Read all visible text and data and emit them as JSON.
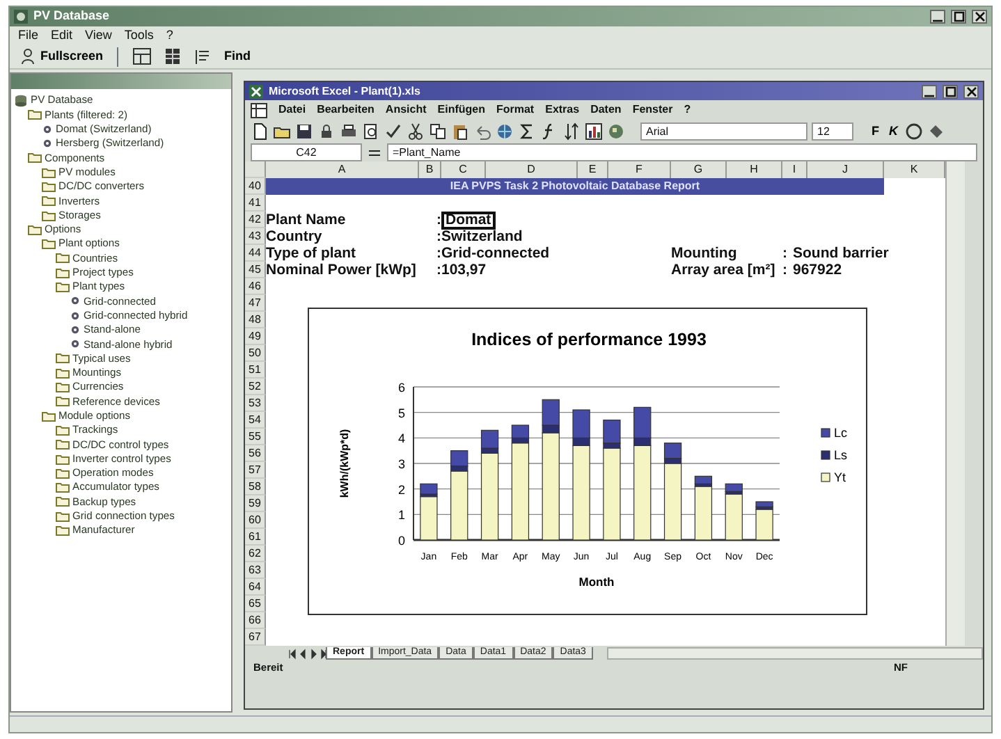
{
  "app": {
    "title": "PV Database",
    "menu": [
      "File",
      "Edit",
      "View",
      "Tools",
      "?"
    ],
    "toolbar": {
      "fullscreen": "Fullscreen",
      "find": "Find"
    }
  },
  "tree": [
    {
      "label": "PV Database",
      "kind": "database",
      "children": [
        {
          "label": "Plants (filtered: 2)",
          "kind": "folder",
          "children": [
            {
              "label": "Domat (Switzerland)",
              "kind": "plant"
            },
            {
              "label": "Hersberg (Switzerland)",
              "kind": "plant"
            }
          ]
        },
        {
          "label": "Components",
          "kind": "folder",
          "children": [
            {
              "label": "PV modules",
              "kind": "folder"
            },
            {
              "label": "DC/DC converters",
              "kind": "folder"
            },
            {
              "label": "Inverters",
              "kind": "folder"
            },
            {
              "label": "Storages",
              "kind": "folder"
            }
          ]
        },
        {
          "label": "Options",
          "kind": "folder",
          "children": [
            {
              "label": "Plant options",
              "kind": "folder",
              "children": [
                {
                  "label": "Countries",
                  "kind": "folder"
                },
                {
                  "label": "Project types",
                  "kind": "folder"
                },
                {
                  "label": "Plant types",
                  "kind": "folder",
                  "children": [
                    {
                      "label": "Grid-connected",
                      "kind": "plant"
                    },
                    {
                      "label": "Grid-connected hybrid",
                      "kind": "plant"
                    },
                    {
                      "label": "Stand-alone",
                      "kind": "plant"
                    },
                    {
                      "label": "Stand-alone hybrid",
                      "kind": "plant"
                    }
                  ]
                },
                {
                  "label": "Typical uses",
                  "kind": "folder"
                },
                {
                  "label": "Mountings",
                  "kind": "folder"
                },
                {
                  "label": "Currencies",
                  "kind": "folder"
                },
                {
                  "label": "Reference devices",
                  "kind": "folder"
                }
              ]
            },
            {
              "label": "Module options",
              "kind": "folder",
              "children": [
                {
                  "label": "Trackings",
                  "kind": "folder"
                },
                {
                  "label": "DC/DC control types",
                  "kind": "folder"
                },
                {
                  "label": "Inverter control types",
                  "kind": "folder"
                },
                {
                  "label": "Operation modes",
                  "kind": "folder"
                },
                {
                  "label": "Accumulator types",
                  "kind": "folder"
                },
                {
                  "label": "Backup types",
                  "kind": "folder"
                },
                {
                  "label": "Grid connection types",
                  "kind": "folder"
                },
                {
                  "label": "Manufacturer",
                  "kind": "folder"
                }
              ]
            }
          ]
        }
      ]
    }
  ],
  "excel": {
    "title": "Microsoft Excel - Plant(1).xls",
    "menu": [
      "Datei",
      "Bearbeiten",
      "Ansicht",
      "Einfügen",
      "Format",
      "Extras",
      "Daten",
      "Fenster",
      "?"
    ],
    "font": "Arial",
    "font_size": "12",
    "bold": "F",
    "italic": "K",
    "name_box": "C42",
    "formula": "=Plant_Name",
    "columns": [
      "A",
      "B",
      "C",
      "D",
      "E",
      "F",
      "G",
      "H",
      "I",
      "J",
      "K"
    ],
    "rows": [
      {
        "number": "40",
        "kind": "banner",
        "text": "IEA PVPS Task 2 Photovoltaic Database Report"
      },
      {
        "number": "41"
      },
      {
        "number": "42",
        "kind": "field",
        "label": "Plant Name",
        "separator": ":",
        "value": "Domat",
        "selected": true
      },
      {
        "number": "43",
        "kind": "field",
        "label": "Country",
        "separator": ":",
        "value": "Switzerland",
        "selected": false
      },
      {
        "number": "44",
        "kind": "field",
        "label": "Type of plant",
        "separator": ":",
        "value": "Grid-connected",
        "selected": false,
        "label_2": "Mounting",
        "separator_2": ":",
        "value_2": "Sound barrier"
      },
      {
        "number": "45",
        "kind": "field",
        "label": "Nominal Power [kWp]",
        "separator": ":",
        "value": "103,97",
        "selected": false,
        "label_2": "Array area [m²]",
        "separator_2": ":",
        "value_2": "967922"
      },
      {
        "number": "46"
      },
      {
        "number": "47"
      },
      {
        "number": "48"
      },
      {
        "number": "49"
      },
      {
        "number": "50"
      },
      {
        "number": "51"
      },
      {
        "number": "52"
      },
      {
        "number": "53"
      },
      {
        "number": "54"
      },
      {
        "number": "55"
      },
      {
        "number": "56"
      },
      {
        "number": "57"
      },
      {
        "number": "58"
      },
      {
        "number": "59"
      },
      {
        "number": "60"
      },
      {
        "number": "61"
      },
      {
        "number": "62"
      },
      {
        "number": "63"
      },
      {
        "number": "64"
      },
      {
        "number": "65"
      },
      {
        "number": "66"
      },
      {
        "number": "67"
      }
    ],
    "chart_data": {
      "type": "bar",
      "title": "Indices of performance 1993",
      "xlabel": "Month",
      "ylabel": "kWh/(kWp*d)",
      "categories": [
        "Jan",
        "Feb",
        "Mar",
        "Apr",
        "May",
        "Jun",
        "Jul",
        "Aug",
        "Sep",
        "Oct",
        "Nov",
        "Dec"
      ],
      "stacked": true,
      "grid": true,
      "legend": true,
      "ylim": [
        0,
        6
      ],
      "yticks": [
        0,
        1,
        2,
        3,
        4,
        5,
        6
      ],
      "series": [
        {
          "name": "Yt",
          "color": "#f4f5c2",
          "values": [
            1.7,
            2.7,
            3.4,
            3.8,
            4.2,
            3.7,
            3.6,
            3.7,
            3.0,
            2.1,
            1.8,
            1.2
          ]
        },
        {
          "name": "Ls",
          "color": "#2b2f72",
          "values": [
            0.1,
            0.2,
            0.2,
            0.2,
            0.3,
            0.3,
            0.2,
            0.3,
            0.2,
            0.1,
            0.1,
            0.1
          ]
        },
        {
          "name": "Lc",
          "color": "#444aa6",
          "values": [
            0.4,
            0.6,
            0.7,
            0.5,
            1.0,
            1.1,
            0.9,
            1.2,
            0.6,
            0.3,
            0.3,
            0.2
          ]
        }
      ]
    },
    "sheet_tabs": [
      {
        "label": "Report",
        "selected": true
      },
      {
        "label": "Import_Data",
        "selected": false
      },
      {
        "label": "Data",
        "selected": false
      },
      {
        "label": "Data1",
        "selected": false
      },
      {
        "label": "Data2",
        "selected": false
      },
      {
        "label": "Data3",
        "selected": false
      }
    ],
    "status": "Bereit",
    "status_right": "NF"
  }
}
